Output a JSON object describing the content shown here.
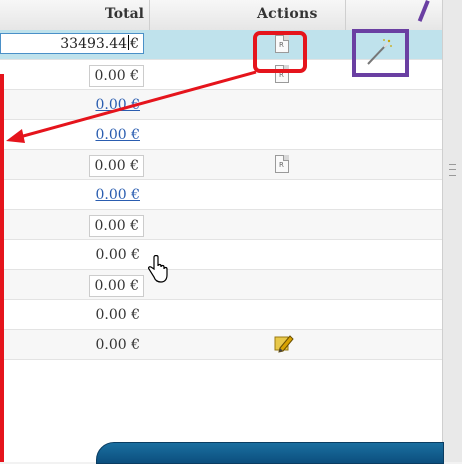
{
  "header": {
    "total_label": "Total",
    "actions_label": "Actions"
  },
  "editing_value": "33493.44",
  "currency_symbol": "€",
  "rows": [
    {
      "total": "0.00 €",
      "style": "boxed",
      "action": "report-icon"
    },
    {
      "total": "0.00 €",
      "style": "link",
      "action": ""
    },
    {
      "total": "0.00 €",
      "style": "link",
      "action": ""
    },
    {
      "total": "0.00 €",
      "style": "boxed",
      "action": "report-icon"
    },
    {
      "total": "0.00 €",
      "style": "link",
      "action": ""
    },
    {
      "total": "0.00 €",
      "style": "boxed",
      "action": ""
    },
    {
      "total": "0.00 €",
      "style": "plain",
      "action": ""
    },
    {
      "total": "0.00 €",
      "style": "boxed",
      "action": ""
    },
    {
      "total": "0.00 €",
      "style": "plain",
      "action": ""
    },
    {
      "total": "0.00 €",
      "style": "plain",
      "action": "edit-pencil-icon"
    }
  ],
  "colors": {
    "selected_row": "#bfe2ec",
    "annotation_red": "#e5141c",
    "annotation_purple": "#6a3fa2",
    "link_blue": "#2a5db0"
  }
}
